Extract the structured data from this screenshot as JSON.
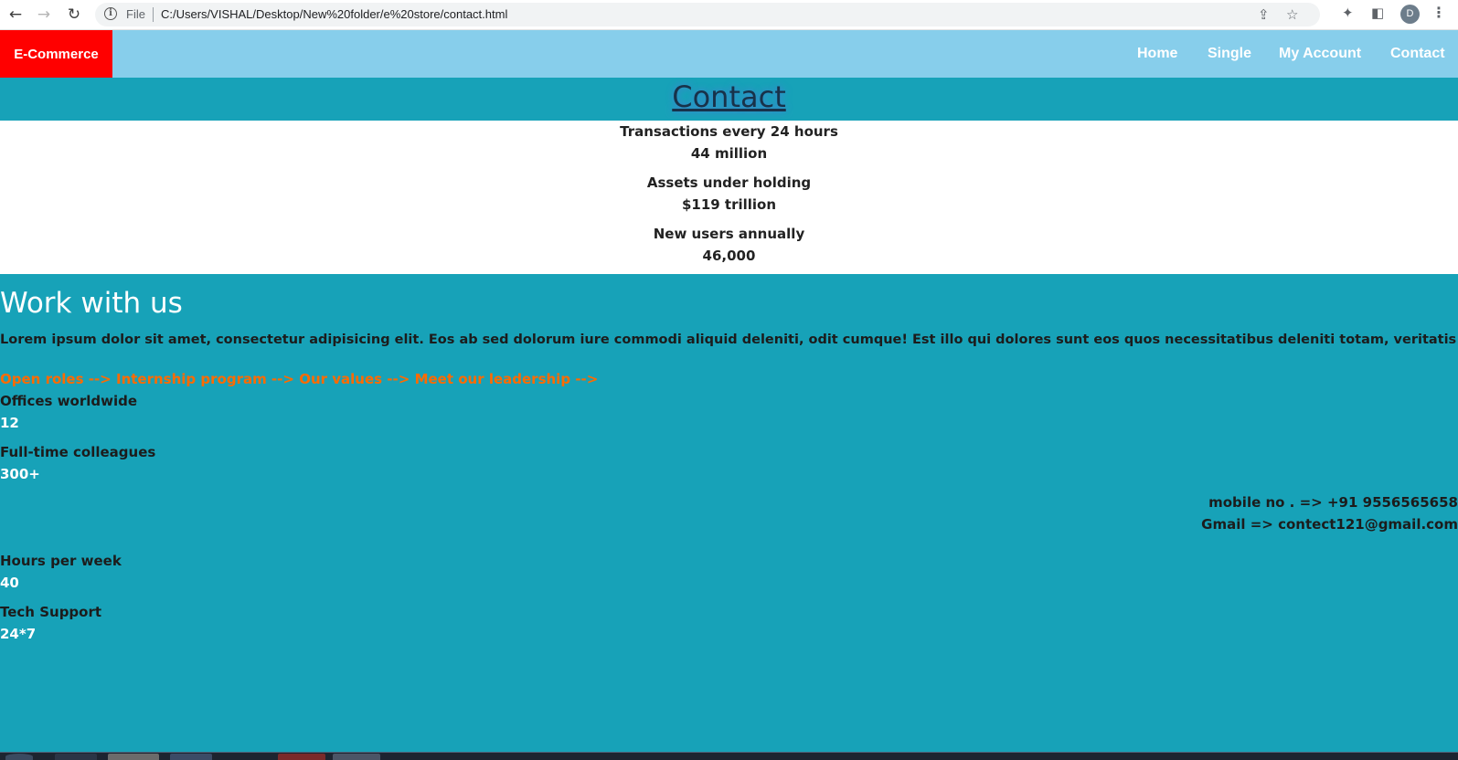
{
  "browser": {
    "file_label": "File",
    "url": "C:/Users/VISHAL/Desktop/New%20folder/e%20store/contact.html",
    "profile_initial": "D"
  },
  "navbar": {
    "brand": "E-Commerce",
    "links": [
      "Home",
      "Single",
      "My Account",
      "Contact"
    ],
    "colors": {
      "bar": "#87ceeb",
      "brand": "#ff0000"
    }
  },
  "contact_header": {
    "title": "Contact"
  },
  "stats": [
    {
      "label": "Transactions every 24 hours",
      "value": "44 million"
    },
    {
      "label": "Assets under holding",
      "value": "$119 trillion"
    },
    {
      "label": "New users annually",
      "value": "46,000"
    }
  ],
  "work": {
    "title": "Work with us",
    "description": "Lorem ipsum dolor sit amet, consectetur adipisicing elit. Eos ab sed dolorum iure commodi aliquid deleniti, odit cumque! Est illo qui dolores sunt eos quos necessitatibus deleniti totam, veritatis odit!",
    "links": [
      "Open roles -->",
      "Internship program -->",
      "Our values -->",
      "Meet our leadership -->"
    ],
    "metrics": [
      {
        "label": "Offices worldwide",
        "value": "12"
      },
      {
        "label": "Full-time colleagues",
        "value": "300+"
      },
      {
        "label": "Hours per week",
        "value": "40"
      },
      {
        "label": "Tech Support",
        "value": "24*7"
      }
    ],
    "contact": {
      "mobile": "mobile no . => +91 9556565658",
      "gmail": "Gmail => contect121@gmail.com"
    },
    "colors": {
      "background": "#17a2b8",
      "links": "#ff6a00"
    }
  }
}
